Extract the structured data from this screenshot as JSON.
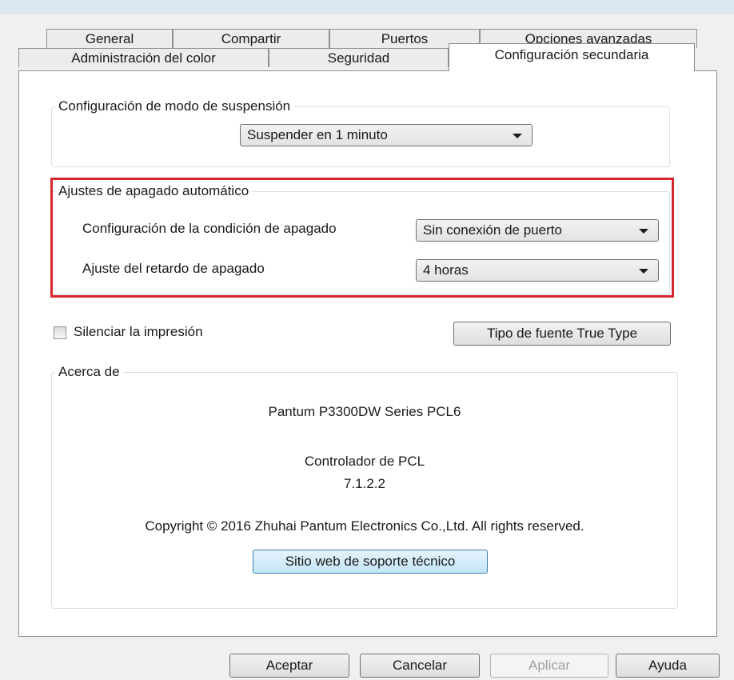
{
  "tabs": {
    "row1": [
      "General",
      "Compartir",
      "Puertos",
      "Opciones avanzadas"
    ],
    "row2": [
      "Administración del color",
      "Seguridad",
      "Configuración secundaria"
    ]
  },
  "sleep": {
    "legend": "Configuración de modo de suspensión",
    "selected": "Suspender en 1 minuto"
  },
  "auto_off": {
    "legend": "Ajustes de apagado automático",
    "condition_label": "Configuración de la condición de apagado",
    "condition_selected": "Sin conexión de puerto",
    "delay_label": "Ajuste del retardo de apagado",
    "delay_selected": "4 horas"
  },
  "silent": {
    "label": "Silenciar la impresión",
    "checked": false
  },
  "truetype_button": "Tipo de fuente True Type",
  "about": {
    "legend": "Acerca de",
    "product": "Pantum P3300DW Series PCL6",
    "driver": "Controlador de PCL",
    "version": "7.1.2.2",
    "copyright": "Copyright © 2016 Zhuhai Pantum Electronics Co.,Ltd. All rights reserved.",
    "support_button": "Sitio web de soporte técnico"
  },
  "buttons": {
    "ok": "Aceptar",
    "cancel": "Cancelar",
    "apply": "Aplicar",
    "help": "Ayuda"
  },
  "colors": {
    "highlight": "#d7262e",
    "window_bg": "#f0f0f0"
  }
}
